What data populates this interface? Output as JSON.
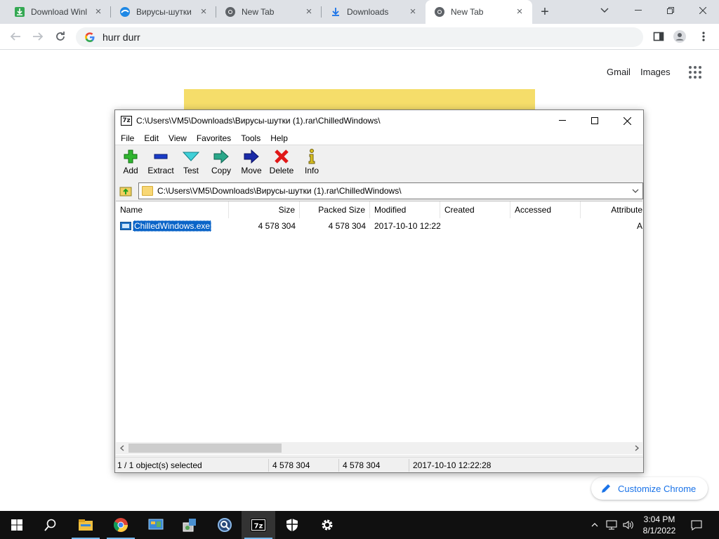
{
  "browser": {
    "tabs": [
      {
        "label": "Download Winl",
        "icon": "download-arrow-icon"
      },
      {
        "label": "Вирусы-шутки",
        "icon": "site-swirl-icon"
      },
      {
        "label": "New Tab",
        "icon": "chrome-icon"
      },
      {
        "label": "Downloads",
        "icon": "download-icon"
      },
      {
        "label": "New Tab",
        "icon": "chrome-icon",
        "active": true
      }
    ],
    "omnibox_value": "hurr durr",
    "ntp_links": {
      "gmail": "Gmail",
      "images": "Images"
    },
    "customize_label": "Customize Chrome"
  },
  "zip": {
    "title": "C:\\Users\\VM5\\Downloads\\Вирусы-шутки (1).rar\\ChilledWindows\\",
    "app_icon_text": "7z",
    "menu": [
      "File",
      "Edit",
      "View",
      "Favorites",
      "Tools",
      "Help"
    ],
    "toolbar": [
      {
        "label": "Add",
        "icon": "add-plus-icon"
      },
      {
        "label": "Extract",
        "icon": "extract-minus-icon"
      },
      {
        "label": "Test",
        "icon": "test-check-icon"
      },
      {
        "label": "Copy",
        "icon": "copy-arrow-icon"
      },
      {
        "label": "Move",
        "icon": "move-arrow-icon"
      },
      {
        "label": "Delete",
        "icon": "delete-x-icon"
      },
      {
        "label": "Info",
        "icon": "info-icon"
      }
    ],
    "address": "C:\\Users\\VM5\\Downloads\\Вирусы-шутки (1).rar\\ChilledWindows\\",
    "columns": [
      "Name",
      "Size",
      "Packed Size",
      "Modified",
      "Created",
      "Accessed",
      "Attribute"
    ],
    "rows": [
      {
        "name": "ChilledWindows.exe",
        "size": "4 578 304",
        "packed": "4 578 304",
        "modified": "2017-10-10 12:22",
        "created": "",
        "accessed": "",
        "attr": "A"
      }
    ],
    "status": {
      "selected": "1 / 1 object(s) selected",
      "size": "4 578 304",
      "packed": "4 578 304",
      "modified": "2017-10-10 12:22:28"
    }
  },
  "taskbar": {
    "time": "3:04 PM",
    "date": "8/1/2022",
    "apps": [
      "file-explorer-icon",
      "chrome-icon",
      "control-panel-icon",
      "installer-icon",
      "search-app-icon",
      "7zip-icon",
      "defender-shield-icon",
      "settings-gear-icon"
    ]
  },
  "colors": {
    "accent": "#1a73e8",
    "selection": "#0a64c8",
    "taskbar": "#101010"
  }
}
